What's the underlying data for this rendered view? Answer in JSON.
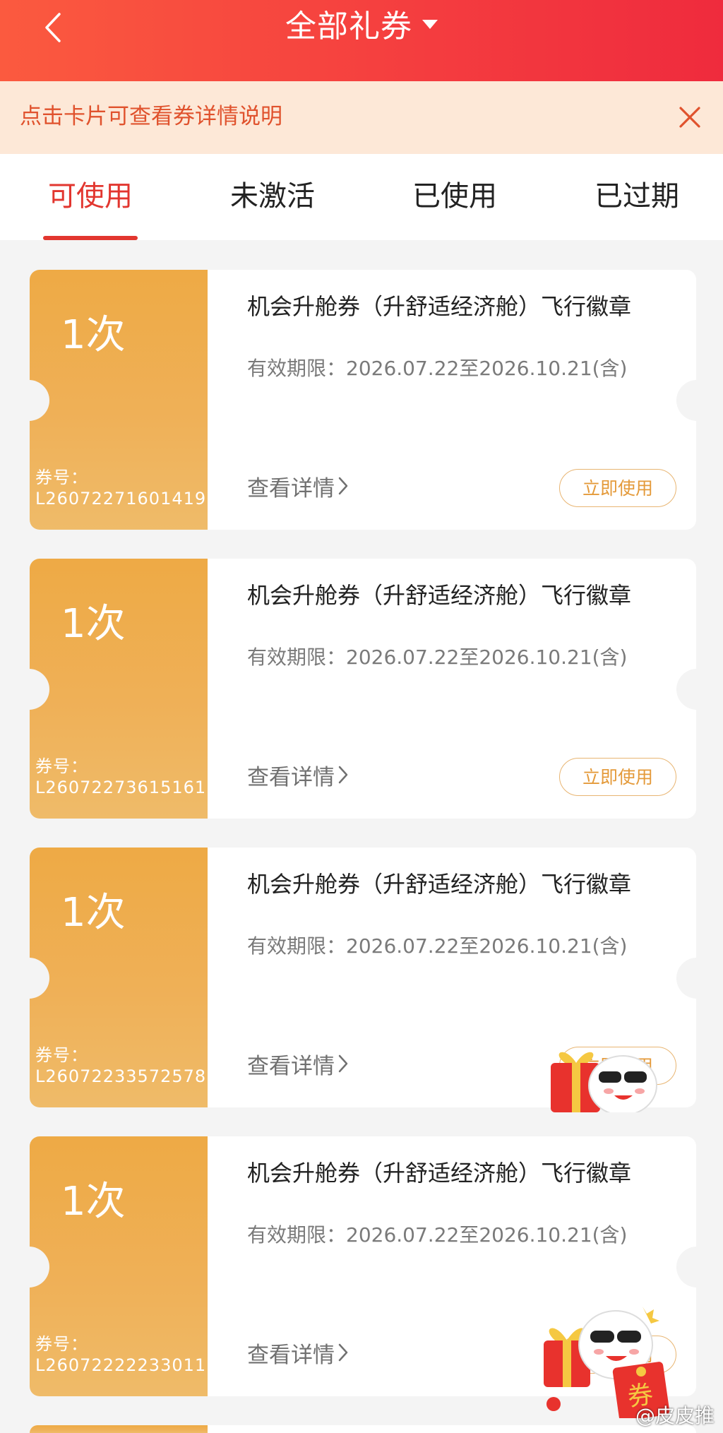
{
  "header": {
    "title": "全部礼券",
    "back_icon": "chevron-left-icon",
    "dropdown_icon": "caret-down-icon",
    "gradient": [
      "#fb5a3f",
      "#ef2b3d"
    ]
  },
  "notice": {
    "text": "点击卡片可查看券详情说明",
    "close_icon": "close-icon",
    "bg": "#fde8d7",
    "text_color": "#e0522d"
  },
  "tabs": [
    {
      "label": "可使用",
      "active": true
    },
    {
      "label": "未激活",
      "active": false
    },
    {
      "label": "已使用",
      "active": false
    },
    {
      "label": "已过期",
      "active": false
    }
  ],
  "accent": "#e2362f",
  "coupons": [
    {
      "times": "1次",
      "code_label": "券号：",
      "code": "L26072271601419",
      "name": "机会升舱券（升舒适经济舱）飞行徽章",
      "validity": "有效期限：2026.07.22至2026.10.21(含)",
      "details_label": "查看详情",
      "use_label": "立即使用"
    },
    {
      "times": "1次",
      "code_label": "券号：",
      "code": "L26072273615161",
      "name": "机会升舱券（升舒适经济舱）飞行徽章",
      "validity": "有效期限：2026.07.22至2026.10.21(含)",
      "details_label": "查看详情",
      "use_label": "立即使用"
    },
    {
      "times": "1次",
      "code_label": "券号：",
      "code": "L26072233572578",
      "name": "机会升舱券（升舒适经济舱）飞行徽章",
      "validity": "有效期限：2026.07.22至2026.10.21(含)",
      "details_label": "查看详情",
      "use_label": "立即使用"
    },
    {
      "times": "1次",
      "code_label": "券号：",
      "code": "L26072222233011",
      "name": "机会升舱券（升舒适经济舱）飞行徽章",
      "validity": "有效期限：2026.07.22至2026.10.21(含)",
      "details_label": "查看详情",
      "use_label": "立即使用"
    }
  ],
  "mascot": {
    "icon": "mascot-red-envelope-icon",
    "badge_text": "券"
  },
  "watermark": "@皮皮推"
}
